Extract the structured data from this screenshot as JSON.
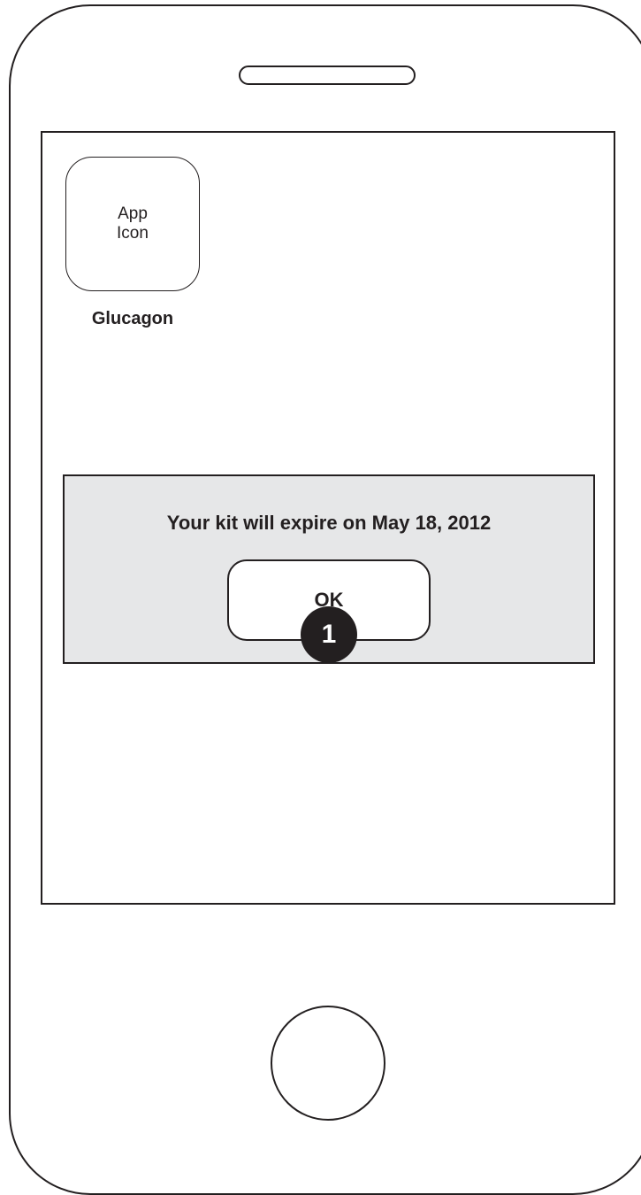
{
  "app": {
    "icon_text": "App Icon",
    "name": "Glucagon"
  },
  "alert": {
    "message": "Your kit will expire on May 18, 2012",
    "ok_label": "OK"
  },
  "annotation": {
    "callout_number": "1"
  },
  "colors": {
    "outline": "#231f20",
    "alert_background": "#e6e7e8",
    "screen_background": "#ffffff"
  }
}
